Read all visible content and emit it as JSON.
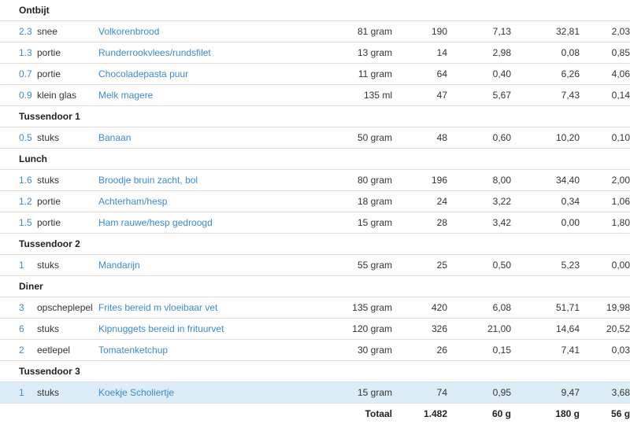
{
  "meals": [
    {
      "name": "Ontbijt",
      "items": [
        {
          "qty": "2.3",
          "unit": "snee",
          "food": "Volkorenbrood",
          "amount": "81 gram",
          "kcal": "190",
          "protein": "7,13",
          "carbs": "32,81",
          "fat": "2,03"
        },
        {
          "qty": "1.3",
          "unit": "portie",
          "food": "Runderrookvlees/rundsfilet",
          "amount": "13 gram",
          "kcal": "14",
          "protein": "2,98",
          "carbs": "0,08",
          "fat": "0,85"
        },
        {
          "qty": "0.7",
          "unit": "portie",
          "food": "Chocoladepasta puur",
          "amount": "11 gram",
          "kcal": "64",
          "protein": "0,40",
          "carbs": "6,26",
          "fat": "4,06"
        },
        {
          "qty": "0.9",
          "unit": "klein glas",
          "food": "Melk magere",
          "amount": "135 ml",
          "kcal": "47",
          "protein": "5,67",
          "carbs": "7,43",
          "fat": "0,14"
        }
      ]
    },
    {
      "name": "Tussendoor 1",
      "items": [
        {
          "qty": "0.5",
          "unit": "stuks",
          "food": "Banaan",
          "amount": "50 gram",
          "kcal": "48",
          "protein": "0,60",
          "carbs": "10,20",
          "fat": "0,10"
        }
      ]
    },
    {
      "name": "Lunch",
      "items": [
        {
          "qty": "1.6",
          "unit": "stuks",
          "food": "Broodje bruin zacht, bol",
          "amount": "80 gram",
          "kcal": "196",
          "protein": "8,00",
          "carbs": "34,40",
          "fat": "2,00"
        },
        {
          "qty": "1.2",
          "unit": "portie",
          "food": "Achterham/hesp",
          "amount": "18 gram",
          "kcal": "24",
          "protein": "3,22",
          "carbs": "0,34",
          "fat": "1,06"
        },
        {
          "qty": "1.5",
          "unit": "portie",
          "food": "Ham rauwe/hesp gedroogd",
          "amount": "15 gram",
          "kcal": "28",
          "protein": "3,42",
          "carbs": "0,00",
          "fat": "1,80"
        }
      ]
    },
    {
      "name": "Tussendoor 2",
      "items": [
        {
          "qty": "1",
          "unit": "stuks",
          "food": "Mandarijn",
          "amount": "55 gram",
          "kcal": "25",
          "protein": "0,50",
          "carbs": "5,23",
          "fat": "0,00"
        }
      ]
    },
    {
      "name": "Diner",
      "items": [
        {
          "qty": "3",
          "unit": "opscheplepel",
          "food": "Frites bereid m vloeibaar vet",
          "amount": "135 gram",
          "kcal": "420",
          "protein": "6,08",
          "carbs": "51,71",
          "fat": "19,98"
        },
        {
          "qty": "6",
          "unit": "stuks",
          "food": "Kipnuggets bereid in frituurvet",
          "amount": "120 gram",
          "kcal": "326",
          "protein": "21,00",
          "carbs": "14,64",
          "fat": "20,52"
        },
        {
          "qty": "2",
          "unit": "eetlepel",
          "food": "Tomatenketchup",
          "amount": "30 gram",
          "kcal": "26",
          "protein": "0,15",
          "carbs": "7,41",
          "fat": "0,03"
        }
      ]
    },
    {
      "name": "Tussendoor 3",
      "items": [
        {
          "qty": "1",
          "unit": "stuks",
          "food": "Koekje Scholiertje",
          "amount": "15 gram",
          "kcal": "74",
          "protein": "0,95",
          "carbs": "9,47",
          "fat": "3,68",
          "highlighted": true
        }
      ]
    }
  ],
  "total": {
    "label": "Totaal",
    "kcal": "1.482",
    "protein": "60 g",
    "carbs": "180 g",
    "fat": "56 g"
  },
  "colors": {
    "link": "#3a8bd1",
    "highlight_row": "#dcedf7",
    "border": "#dddddd"
  }
}
